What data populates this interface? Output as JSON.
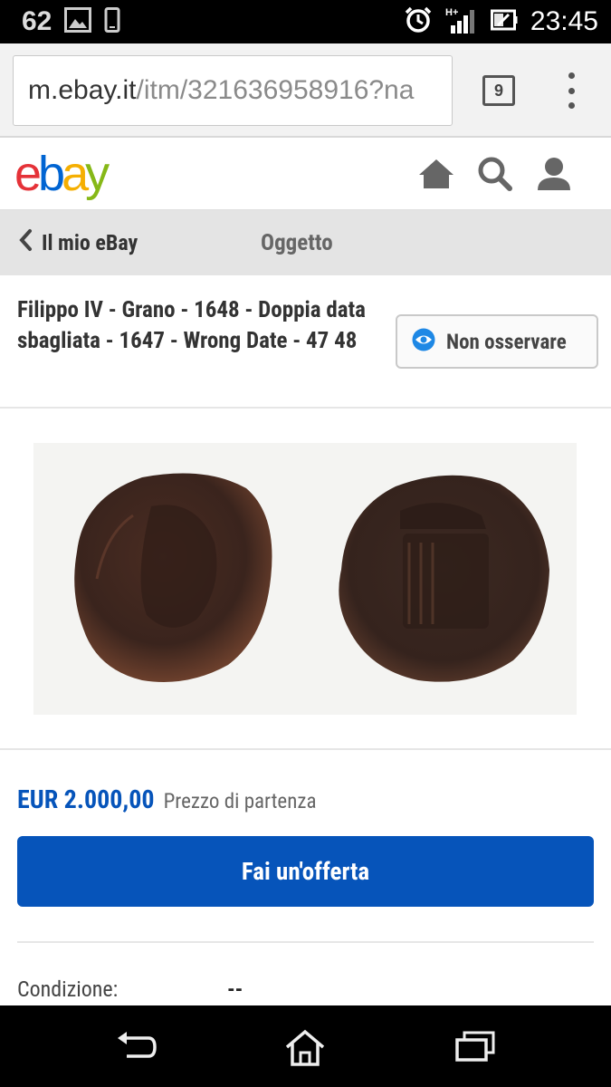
{
  "status_bar": {
    "left_number": "62",
    "time": "23:45",
    "network": "H+"
  },
  "browser": {
    "url_domain": "m.ebay.it",
    "url_path": "/itm/321636958916?na",
    "tab_count": "9"
  },
  "header": {
    "logo": {
      "e": "e",
      "b": "b",
      "a": "a",
      "y": "y"
    }
  },
  "subnav": {
    "back_label": "Il mio eBay",
    "title": "Oggetto"
  },
  "item": {
    "title": "Filippo IV - Grano - 1648 - Doppia data sbagliata - 1647 - Wrong Date - 47 48",
    "watch_label": "Non osservare",
    "price": "EUR 2.000,00",
    "price_label": "Prezzo di partenza",
    "offer_button": "Fai un'offerta",
    "condition_label": "Condizione:",
    "condition_value": "--"
  },
  "colors": {
    "ebay_red": "#e53238",
    "ebay_blue": "#0064d2",
    "ebay_yellow": "#f5af02",
    "ebay_green": "#86b817",
    "primary": "#0654ba"
  }
}
